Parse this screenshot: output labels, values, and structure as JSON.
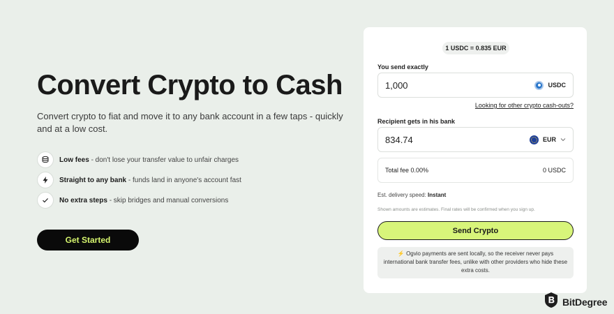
{
  "hero": {
    "title": "Convert Crypto to Cash",
    "subtitle": "Convert crypto to fiat and move it to any bank account in a few taps - quickly and at a low cost.",
    "features": [
      {
        "icon": "coins-icon",
        "bold": "Low fees",
        "text": " - don't lose your transfer value to unfair charges"
      },
      {
        "icon": "lightning-icon",
        "bold": "Straight to any bank",
        "text": " - funds land in anyone's account fast"
      },
      {
        "icon": "check-icon",
        "bold": "No extra steps",
        "text": " - skip bridges and manual conversions"
      }
    ],
    "cta_label": "Get Started"
  },
  "converter": {
    "rate": "1 USDC = 0.835 EUR",
    "send_label": "You send exactly",
    "send_value": "1,000",
    "send_currency": "USDC",
    "other_link": "Looking for other crypto cash-outs?",
    "receive_label": "Recipient gets in his bank",
    "receive_value": "834.74",
    "receive_currency": "EUR",
    "fee_label": "Total fee 0.00%",
    "fee_value": "0 USDC",
    "delivery_label": "Est. delivery speed: ",
    "delivery_value": "Instant",
    "disclaimer": "Shown amounts are estimates. Final rates will be confirmed when you sign up.",
    "send_button": "Send Crypto",
    "note": "Ogvio payments are sent locally, so the receiver never pays international bank transfer fees, unlike with other providers who hide these extra costs."
  },
  "watermark": {
    "text": "BitDegree"
  },
  "colors": {
    "accent": "#d8f57a",
    "cta_text": "#d6f56e",
    "background": "#eaefea"
  }
}
